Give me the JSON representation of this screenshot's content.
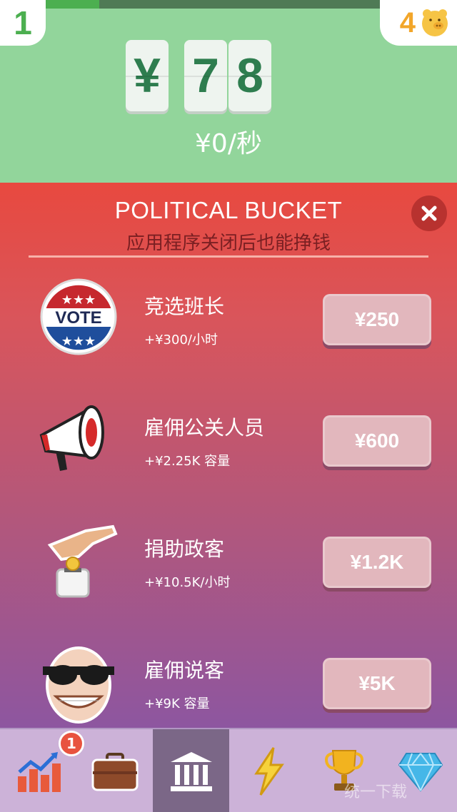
{
  "header": {
    "level": "1",
    "coins": "4",
    "progress": 0.16,
    "money_digits": [
      "¥",
      "7",
      "8"
    ],
    "rate": "¥0/秒"
  },
  "panel": {
    "title": "POLITICAL BUCKET",
    "subtitle": "应用程序关闭后也能挣钱",
    "items": [
      {
        "name": "竞选班长",
        "detail": "+¥300/小时",
        "price": "¥250",
        "icon": "vote-badge-icon"
      },
      {
        "name": "雇佣公关人员",
        "detail": "+¥2.25K 容量",
        "price": "¥600",
        "icon": "megaphone-icon"
      },
      {
        "name": "捐助政客",
        "detail": "+¥10.5K/小时",
        "price": "¥1.2K",
        "icon": "donation-hand-icon"
      },
      {
        "name": "雇佣说客",
        "detail": "+¥9K 容量",
        "price": "¥5K",
        "icon": "lobbyist-face-icon"
      }
    ]
  },
  "nav": {
    "badge": "1",
    "tabs": [
      "chart-icon",
      "briefcase-icon",
      "bank-icon",
      "lightning-icon",
      "trophy-icon",
      "diamond-icon"
    ]
  },
  "watermark": "统一下载"
}
